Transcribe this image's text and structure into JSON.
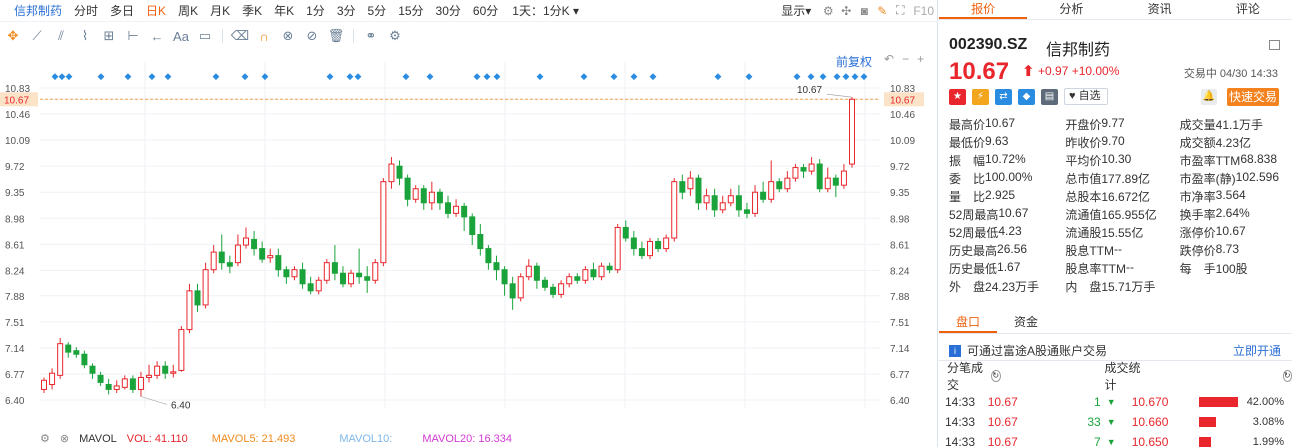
{
  "toolbar1": {
    "stock_name": "信邦制药",
    "periods": [
      "分时",
      "多日",
      "日K",
      "周K",
      "月K",
      "季K",
      "年K",
      "1分",
      "3分",
      "5分",
      "15分",
      "30分",
      "60分"
    ],
    "active_period": "日K",
    "time_dropdown": "1天：1分K",
    "display_dropdown": "显示",
    "f10": "F10"
  },
  "fq_label": "前复权",
  "chart": {
    "y_ticks": [
      "10.83",
      "10.67",
      "10.46",
      "10.09",
      "9.72",
      "9.35",
      "8.98",
      "8.61",
      "8.24",
      "7.88",
      "7.51",
      "7.14",
      "6.77",
      "6.40"
    ],
    "current_price_label": "10.67",
    "high_annotation": "10.67",
    "low_annotation": "6.40",
    "ylim": [
      6.4,
      10.83
    ],
    "up_color": "#e8262c",
    "down_color": "#1aa33a"
  },
  "chart_data": {
    "type": "candlestick",
    "ylim": [
      6.4,
      10.83
    ],
    "candles": [
      [
        6.55,
        6.68,
        6.5,
        6.72
      ],
      [
        6.62,
        6.78,
        6.55,
        6.85
      ],
      [
        6.75,
        7.2,
        6.7,
        7.28
      ],
      [
        7.18,
        7.08,
        7.0,
        7.22
      ],
      [
        7.1,
        7.05,
        7.0,
        7.15
      ],
      [
        7.05,
        6.9,
        6.85,
        7.1
      ],
      [
        6.88,
        6.78,
        6.7,
        6.92
      ],
      [
        6.75,
        6.65,
        6.6,
        6.8
      ],
      [
        6.62,
        6.55,
        6.48,
        6.7
      ],
      [
        6.55,
        6.6,
        6.5,
        6.68
      ],
      [
        6.58,
        6.7,
        6.55,
        6.75
      ],
      [
        6.7,
        6.55,
        6.5,
        6.75
      ],
      [
        6.55,
        6.72,
        6.45,
        6.8
      ],
      [
        6.72,
        6.75,
        6.65,
        6.9
      ],
      [
        6.75,
        6.88,
        6.7,
        6.95
      ],
      [
        6.88,
        6.78,
        6.7,
        6.95
      ],
      [
        6.78,
        6.8,
        6.72,
        6.9
      ],
      [
        6.82,
        7.4,
        6.8,
        7.45
      ],
      [
        7.4,
        7.95,
        7.35,
        8.05
      ],
      [
        7.95,
        7.75,
        7.65,
        8.05
      ],
      [
        7.75,
        8.25,
        7.7,
        8.35
      ],
      [
        8.25,
        8.5,
        8.2,
        8.6
      ],
      [
        8.5,
        8.35,
        8.25,
        8.75
      ],
      [
        8.35,
        8.3,
        8.2,
        8.45
      ],
      [
        8.35,
        8.6,
        8.3,
        8.75
      ],
      [
        8.6,
        8.7,
        8.55,
        8.85
      ],
      [
        8.68,
        8.55,
        8.45,
        8.8
      ],
      [
        8.55,
        8.4,
        8.35,
        8.65
      ],
      [
        8.42,
        8.45,
        8.35,
        8.55
      ],
      [
        8.45,
        8.25,
        8.15,
        8.55
      ],
      [
        8.25,
        8.15,
        8.05,
        8.3
      ],
      [
        8.15,
        8.25,
        8.1,
        8.3
      ],
      [
        8.25,
        8.05,
        7.98,
        8.35
      ],
      [
        8.05,
        7.95,
        7.9,
        8.15
      ],
      [
        7.95,
        8.1,
        7.9,
        8.15
      ],
      [
        8.1,
        8.35,
        8.05,
        8.4
      ],
      [
        8.35,
        8.2,
        8.1,
        8.6
      ],
      [
        8.2,
        8.05,
        8.0,
        8.3
      ],
      [
        8.05,
        8.2,
        8.0,
        8.25
      ],
      [
        8.2,
        8.15,
        8.05,
        8.55
      ],
      [
        8.15,
        8.1,
        7.92,
        8.3
      ],
      [
        8.1,
        8.35,
        8.05,
        8.4
      ],
      [
        8.35,
        9.5,
        8.3,
        9.55
      ],
      [
        9.5,
        9.75,
        9.4,
        9.85
      ],
      [
        9.72,
        9.55,
        9.45,
        9.8
      ],
      [
        9.55,
        9.25,
        9.15,
        9.6
      ],
      [
        9.25,
        9.4,
        9.2,
        9.45
      ],
      [
        9.4,
        9.2,
        9.1,
        9.45
      ],
      [
        9.2,
        9.35,
        9.1,
        9.5
      ],
      [
        9.35,
        9.2,
        9.1,
        9.4
      ],
      [
        9.2,
        9.05,
        8.98,
        9.3
      ],
      [
        9.05,
        9.15,
        9.0,
        9.25
      ],
      [
        9.15,
        9.0,
        8.8,
        9.2
      ],
      [
        9.0,
        8.75,
        8.6,
        9.05
      ],
      [
        8.75,
        8.55,
        8.45,
        8.9
      ],
      [
        8.55,
        8.35,
        8.25,
        8.6
      ],
      [
        8.35,
        8.25,
        8.1,
        8.45
      ],
      [
        8.25,
        8.05,
        7.88,
        8.3
      ],
      [
        8.05,
        7.85,
        7.68,
        8.15
      ],
      [
        7.85,
        8.15,
        7.8,
        8.2
      ],
      [
        8.15,
        8.3,
        8.1,
        8.4
      ],
      [
        8.3,
        8.1,
        7.98,
        8.35
      ],
      [
        8.1,
        8.0,
        7.95,
        8.15
      ],
      [
        8.0,
        7.9,
        7.85,
        8.05
      ],
      [
        7.9,
        8.05,
        7.85,
        8.1
      ],
      [
        8.05,
        8.15,
        8.0,
        8.2
      ],
      [
        8.15,
        8.1,
        8.05,
        8.2
      ],
      [
        8.1,
        8.25,
        8.05,
        8.3
      ],
      [
        8.25,
        8.15,
        8.1,
        8.35
      ],
      [
        8.15,
        8.3,
        8.1,
        8.35
      ],
      [
        8.3,
        8.25,
        8.2,
        8.35
      ],
      [
        8.25,
        8.85,
        8.2,
        8.9
      ],
      [
        8.85,
        8.7,
        8.65,
        8.95
      ],
      [
        8.7,
        8.55,
        8.45,
        8.8
      ],
      [
        8.55,
        8.45,
        8.4,
        8.65
      ],
      [
        8.45,
        8.65,
        8.4,
        8.7
      ],
      [
        8.65,
        8.55,
        8.5,
        8.7
      ],
      [
        8.55,
        8.7,
        8.5,
        8.75
      ],
      [
        8.7,
        9.5,
        8.65,
        9.55
      ],
      [
        9.5,
        9.35,
        9.25,
        9.6
      ],
      [
        9.4,
        9.55,
        9.3,
        9.65
      ],
      [
        9.55,
        9.2,
        9.1,
        9.6
      ],
      [
        9.2,
        9.3,
        9.1,
        9.4
      ],
      [
        9.3,
        9.1,
        9.0,
        9.4
      ],
      [
        9.1,
        9.2,
        9.05,
        9.3
      ],
      [
        9.2,
        9.3,
        9.15,
        9.4
      ],
      [
        9.3,
        9.1,
        9.0,
        9.45
      ],
      [
        9.1,
        9.05,
        8.98,
        9.2
      ],
      [
        9.05,
        9.35,
        9.0,
        9.45
      ],
      [
        9.35,
        9.25,
        9.2,
        9.5
      ],
      [
        9.25,
        9.5,
        9.2,
        9.8
      ],
      [
        9.5,
        9.4,
        9.35,
        9.55
      ],
      [
        9.4,
        9.55,
        9.35,
        9.65
      ],
      [
        9.55,
        9.7,
        9.5,
        9.75
      ],
      [
        9.7,
        9.65,
        9.55,
        9.75
      ],
      [
        9.65,
        9.75,
        9.6,
        9.85
      ],
      [
        9.75,
        9.4,
        9.35,
        9.82
      ],
      [
        9.4,
        9.55,
        9.35,
        9.7
      ],
      [
        9.55,
        9.45,
        9.28,
        9.6
      ],
      [
        9.45,
        9.65,
        9.4,
        9.75
      ],
      [
        9.75,
        10.67,
        9.7,
        10.7
      ]
    ]
  },
  "status": {
    "mavol": "MAVOL",
    "vol": "VOL: 41.110",
    "mavol5": "MAVOL5: 21.493",
    "mavol10": "MAVOL10:",
    "mavol20": "MAVOL20: 16.334"
  },
  "right": {
    "tabs": [
      "报价",
      "分析",
      "资讯",
      "评论"
    ],
    "active_tab": "报价",
    "code": "002390.SZ",
    "name": "信邦制药",
    "price": "10.67",
    "change": "+0.97  +10.00%",
    "trade_status": "交易中 04/30 14:33",
    "watch": "自选",
    "fast_trade": "快速交易",
    "stats": [
      [
        {
          "l": "最高价",
          "v": "10.67",
          "c": "red"
        },
        {
          "l": "开盘价",
          "v": "9.77",
          "c": "red"
        },
        {
          "l": "成交量",
          "v": "41.1万手",
          "c": ""
        }
      ],
      [
        {
          "l": "最低价",
          "v": "9.63",
          "c": "green"
        },
        {
          "l": "昨收价",
          "v": "9.70",
          "c": ""
        },
        {
          "l": "成交额",
          "v": "4.23亿",
          "c": ""
        }
      ],
      [
        {
          "l": "振　幅",
          "v": "10.72%",
          "c": ""
        },
        {
          "l": "平均价",
          "v": "10.30",
          "c": "red"
        },
        {
          "l": "市盈率TTM",
          "v": "68.838",
          "c": ""
        }
      ],
      [
        {
          "l": "委　比",
          "v": "100.00%",
          "c": ""
        },
        {
          "l": "总市值",
          "v": "177.89亿",
          "c": ""
        },
        {
          "l": "市盈率(静)",
          "v": "102.596",
          "c": ""
        }
      ],
      [
        {
          "l": "量　比",
          "v": "2.925",
          "c": ""
        },
        {
          "l": "总股本",
          "v": "16.672亿",
          "c": ""
        },
        {
          "l": "市净率",
          "v": "3.564",
          "c": ""
        }
      ],
      [
        {
          "l": "52周最高",
          "v": "10.67",
          "c": "red"
        },
        {
          "l": "流通值",
          "v": "165.955亿",
          "c": ""
        },
        {
          "l": "换手率",
          "v": "2.64%",
          "c": ""
        }
      ],
      [
        {
          "l": "52周最低",
          "v": "4.23",
          "c": "green"
        },
        {
          "l": "流通股",
          "v": "15.55亿",
          "c": ""
        },
        {
          "l": "涨停价",
          "v": "10.67",
          "c": "red"
        }
      ],
      [
        {
          "l": "历史最高",
          "v": "26.56",
          "c": "red"
        },
        {
          "l": "股息TTM",
          "v": "--",
          "c": ""
        },
        {
          "l": "跌停价",
          "v": "8.73",
          "c": "green"
        }
      ],
      [
        {
          "l": "历史最低",
          "v": "1.67",
          "c": "green"
        },
        {
          "l": "股息率TTM",
          "v": "--",
          "c": ""
        },
        {
          "l": "每　手",
          "v": "100股",
          "c": ""
        }
      ],
      [
        {
          "l": "外　盘",
          "v": "24.23万手",
          "c": "red"
        },
        {
          "l": "内　盘",
          "v": "15.71万手",
          "c": "green"
        },
        {
          "l": "",
          "v": "",
          "c": ""
        }
      ]
    ],
    "panel_tabs": [
      "盘口",
      "资金"
    ],
    "active_panel_tab": "盘口",
    "hk_text": "可通过富途A股通账户交易",
    "hk_open": "立即开通",
    "trades_title": "分笔成交",
    "stats_title": "成交统计",
    "trades": [
      {
        "time": "14:33",
        "price": "10.67",
        "vol": "1",
        "price2": "10.670",
        "pct": "42.00%",
        "fill": 0.42
      },
      {
        "time": "14:33",
        "price": "10.67",
        "vol": "33",
        "price2": "10.660",
        "pct": "3.08%",
        "fill": 0.18
      },
      {
        "time": "14:33",
        "price": "10.67",
        "vol": "7",
        "price2": "10.650",
        "pct": "1.99%",
        "fill": 0.12
      }
    ]
  }
}
